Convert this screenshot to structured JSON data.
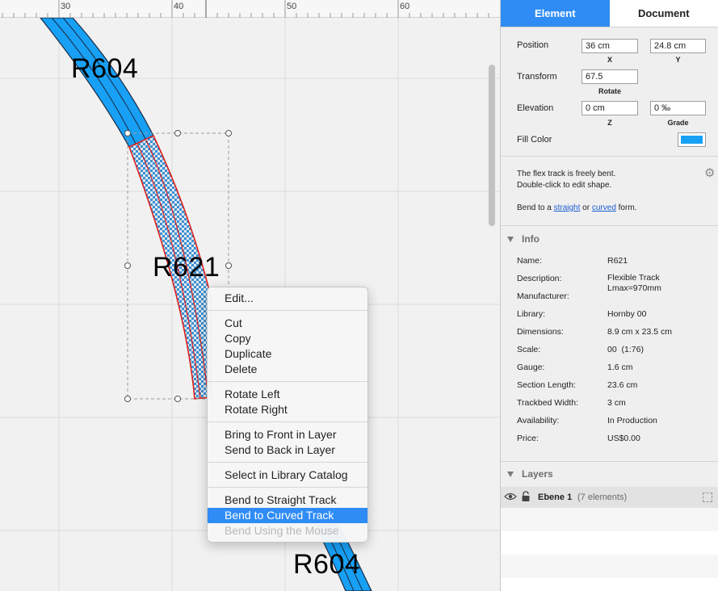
{
  "canvas": {
    "ruler": [
      "30",
      "40",
      "50",
      "60"
    ],
    "track_labels": [
      "R604",
      "R621",
      "R604"
    ],
    "colors": {
      "track": "#18a0f5",
      "selected_outline": "#e0201c"
    }
  },
  "context_menu": {
    "groups": [
      [
        {
          "label": "Edit..."
        }
      ],
      [
        {
          "label": "Cut"
        },
        {
          "label": "Copy"
        },
        {
          "label": "Duplicate"
        },
        {
          "label": "Delete"
        }
      ],
      [
        {
          "label": "Rotate Left"
        },
        {
          "label": "Rotate Right"
        }
      ],
      [
        {
          "label": "Bring to Front in Layer"
        },
        {
          "label": "Send to Back in Layer"
        }
      ],
      [
        {
          "label": "Select in Library Catalog"
        }
      ],
      [
        {
          "label": "Bend to Straight Track"
        },
        {
          "label": "Bend to Curved Track",
          "highlighted": true
        },
        {
          "label": "Bend Using the Mouse",
          "disabled": true
        }
      ]
    ]
  },
  "inspector": {
    "tabs": [
      "Element",
      "Document"
    ],
    "active_tab": "Element",
    "position_label": "Position",
    "position_x": "36 cm",
    "position_y": "24.8 cm",
    "x_label": "X",
    "y_label": "Y",
    "transform_label": "Transform",
    "rotate_value": "67.5",
    "rotate_label": "Rotate",
    "elevation_label": "Elevation",
    "z_value": "0 cm",
    "grade_value": "0 ‰",
    "z_label": "Z",
    "grade_label": "Grade",
    "fill_color_label": "Fill Color",
    "fill_color": "#18a0f5",
    "note_line1": "The flex track is freely bent.",
    "note_line2": "Double-click to edit shape.",
    "bend_prefix": "Bend to a",
    "bend_straight": "straight",
    "bend_or": "or",
    "bend_curved": "curved",
    "bend_suffix": "form.",
    "info_title": "Info",
    "info": [
      {
        "key": "Name:",
        "value": "R621"
      },
      {
        "key": "Description:",
        "value": "Flexible Track Lmax=970mm"
      },
      {
        "key": "Manufacturer:",
        "value": ""
      },
      {
        "key": "Library:",
        "value": "Hornby 00"
      },
      {
        "key": "Dimensions:",
        "value": "8.9 cm x 23.5 cm"
      },
      {
        "key": "Scale:",
        "value": "00  (1:76)"
      },
      {
        "key": "Gauge:",
        "value": "1.6 cm"
      },
      {
        "key": "Section Length:",
        "value": "23.6 cm"
      },
      {
        "key": "Trackbed Width:",
        "value": "3 cm"
      },
      {
        "key": "Availability:",
        "value": "In Production"
      },
      {
        "key": "Price:",
        "value": "US$0.00"
      }
    ],
    "layers_title": "Layers",
    "layer": {
      "name": "Ebene 1",
      "count": "(7 elements)"
    }
  }
}
